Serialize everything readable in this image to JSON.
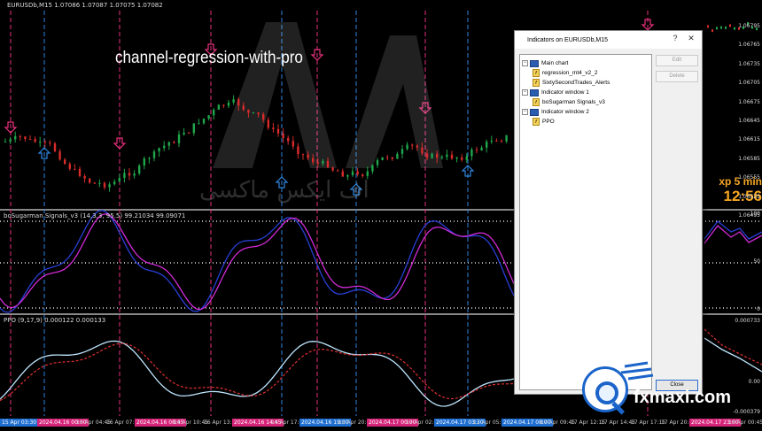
{
  "window": {
    "symbol_header": "EURUSDb,M15",
    "ohlc": "1.07086 1.07087 1.07075 1.07082"
  },
  "overlay_label": "channel-regression-with-pro",
  "expiry": {
    "label": "xp 5 min",
    "time": "12:56"
  },
  "watermark": {
    "arabic": "اف ایکس ماکسی"
  },
  "price_axis": [
    "1.06795",
    "1.06765",
    "1.06735",
    "1.06705",
    "1.06675",
    "1.06645",
    "1.06615",
    "1.06585",
    "1.06555",
    "1.06525",
    "1.06495"
  ],
  "pane2": {
    "title": "boSugarman Signals_v3 (14,3,3, 95.5) 99.21034 99.09071",
    "axis": [
      "100",
      "50",
      "0"
    ]
  },
  "pane3": {
    "title": "PPO (9,17,9) 0.000122 0.000133",
    "axis": [
      "0.000733",
      "0.00",
      "-0.000379"
    ]
  },
  "time_axis": [
    {
      "text": "15 Apr 03:30",
      "style": "blue"
    },
    {
      "text": "2024.04.16 00:00",
      "style": "pink"
    },
    {
      "text": "16 Apr 04:45",
      "style": ""
    },
    {
      "text": "16 Apr 07:15",
      "style": ""
    },
    {
      "text": "2024.04.16 08:45",
      "style": "pink"
    },
    {
      "text": "16 Apr 10:45",
      "style": ""
    },
    {
      "text": "16 Apr 13:15",
      "style": ""
    },
    {
      "text": "2024.04.16 14:45",
      "style": "pink"
    },
    {
      "text": "16 Apr 17:45",
      "style": ""
    },
    {
      "text": "2024.04.16 19:30",
      "style": "blue"
    },
    {
      "text": "16 Apr 20:45",
      "style": ""
    },
    {
      "text": "2024.04.17 00:00",
      "style": "pink"
    },
    {
      "text": "17 Apr 02:45",
      "style": ""
    },
    {
      "text": "2024.04.17 03:30",
      "style": "blue"
    },
    {
      "text": "17 Apr 05:15",
      "style": ""
    },
    {
      "text": "2024.04.17 08:00",
      "style": "blue"
    },
    {
      "text": "17 Apr 09:45",
      "style": ""
    },
    {
      "text": "17 Apr 12:15",
      "style": ""
    },
    {
      "text": "17 Apr 14:45",
      "style": ""
    },
    {
      "text": "17 Apr 17:15",
      "style": ""
    },
    {
      "text": "17 Apr 20:45",
      "style": ""
    },
    {
      "text": "2024.04.17 23:00",
      "style": "pink"
    },
    {
      "text": "18 Apr 00:45",
      "style": ""
    }
  ],
  "dialog": {
    "title": "Indicators on EURUSDb,M15",
    "help": "?",
    "close_x": "✕",
    "tree": [
      {
        "level": 0,
        "type": "window",
        "label": "Main chart"
      },
      {
        "level": 1,
        "type": "fx",
        "label": "regression_mt4_v2_2"
      },
      {
        "level": 1,
        "type": "fx",
        "label": "SixtySecondTrades_Alerts"
      },
      {
        "level": 0,
        "type": "window",
        "label": "Indicator window 1"
      },
      {
        "level": 1,
        "type": "fx",
        "label": "boSugarman Signals_v3"
      },
      {
        "level": 0,
        "type": "window",
        "label": "Indicator window 2"
      },
      {
        "level": 1,
        "type": "fx",
        "label": "PPO"
      }
    ],
    "buttons": {
      "edit": "Edit",
      "delete": "Delete",
      "close": "Close"
    }
  },
  "logo": {
    "text": "fxmaxi.com"
  },
  "colors": {
    "pink_signal": "#e8317e",
    "blue_signal": "#2f86e0",
    "candle_up": "#1fa64a",
    "candle_down": "#d92b2b",
    "stoch_main": "#2a3fd6",
    "stoch_signal": "#d12ad6",
    "ppo_main": "#bfe6ff",
    "ppo_signal": "#e03030"
  }
}
